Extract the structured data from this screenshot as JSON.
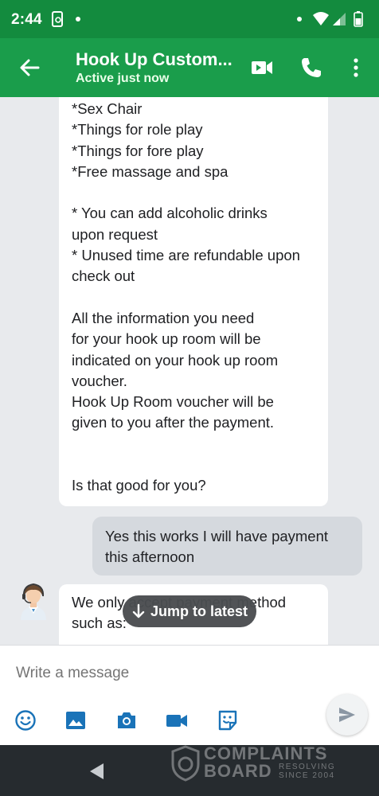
{
  "status_bar": {
    "time": "2:44"
  },
  "header": {
    "title": "Hook Up Custom...",
    "subtitle": "Active just now"
  },
  "messages": {
    "incoming_1": [
      "*Sex Chair",
      "*Things for role play",
      "*Things for fore play",
      "*Free massage and spa",
      "",
      "* You can add alcoholic drinks",
      "upon request",
      "* Unused time are refundable upon",
      "check out",
      "",
      "All the information you need",
      "for your hook up room will be",
      "indicated on your hook up room",
      "voucher.",
      "Hook Up Room voucher will be",
      "given to you after the payment.",
      "",
      "",
      "Is that good for you?"
    ],
    "outgoing_1": "Yes this works I will have payment this afternoon",
    "incoming_2": [
      "We only accept payment method",
      "such as:"
    ]
  },
  "jump_button": {
    "label": "Jump to latest"
  },
  "composer": {
    "placeholder": "Write a message"
  },
  "watermark": {
    "line1": "COMPLAINTS",
    "line2": "BOARD",
    "tag1": "RESOLVING",
    "tag2": "SINCE 2004"
  },
  "colors": {
    "status_bar": "#138b3e",
    "app_bar": "#1a9d4b",
    "chat_bg": "#e8eaed",
    "outgoing_bubble": "#d5d9de",
    "nav_bar": "#262b2f"
  }
}
